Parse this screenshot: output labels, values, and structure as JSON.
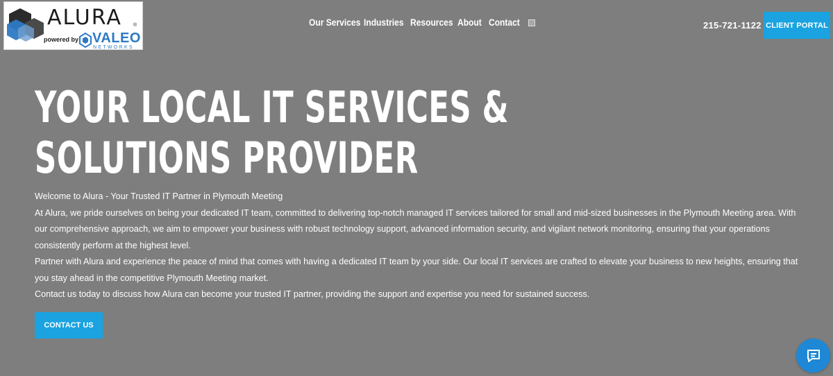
{
  "brand": {
    "name": "ALURA",
    "registered": "®",
    "powered_by": "powered by",
    "partner": "VALEO",
    "partner_sub": "NETWORKS"
  },
  "nav": {
    "items": [
      {
        "label": "Our Services"
      },
      {
        "label": "Industries"
      },
      {
        "label": "Resources"
      },
      {
        "label": "About"
      },
      {
        "label": "Contact"
      }
    ],
    "search_icon": "search-icon"
  },
  "header": {
    "phone": "215-721-1122",
    "portal_label": "CLIENT PORTAL"
  },
  "hero": {
    "title_line1": "YOUR LOCAL IT SERVICES &",
    "title_line2": "SOLUTIONS PROVIDER",
    "paragraphs": [
      "Welcome to Alura - Your Trusted IT Partner in Plymouth Meeting",
      "At Alura, we pride ourselves on being your dedicated IT team, committed to delivering top-notch managed IT services tailored for small and mid-sized businesses in the Plymouth Meeting area. With our comprehensive approach, we aim to empower your business with robust technology support, advanced information security, and vigilant network monitoring, ensuring that your operations consistently perform at the highest level.",
      "Partner with Alura and experience the peace of mind that comes with having a dedicated IT team by your side. Our local IT services are crafted to elevate your business to new heights, ensuring that you stay ahead in the competitive Plymouth Meeting market.",
      "Contact us today to discuss how Alura can become your trusted IT partner, providing the support and expertise you need for sustained success."
    ],
    "cta_label": "CONTACT US"
  },
  "chat": {
    "icon": "chat-icon"
  },
  "colors": {
    "background": "#7e7e7e",
    "accent": "#1aa3e0",
    "chat": "#1e88d6",
    "partner_blue": "#2d79c4"
  }
}
